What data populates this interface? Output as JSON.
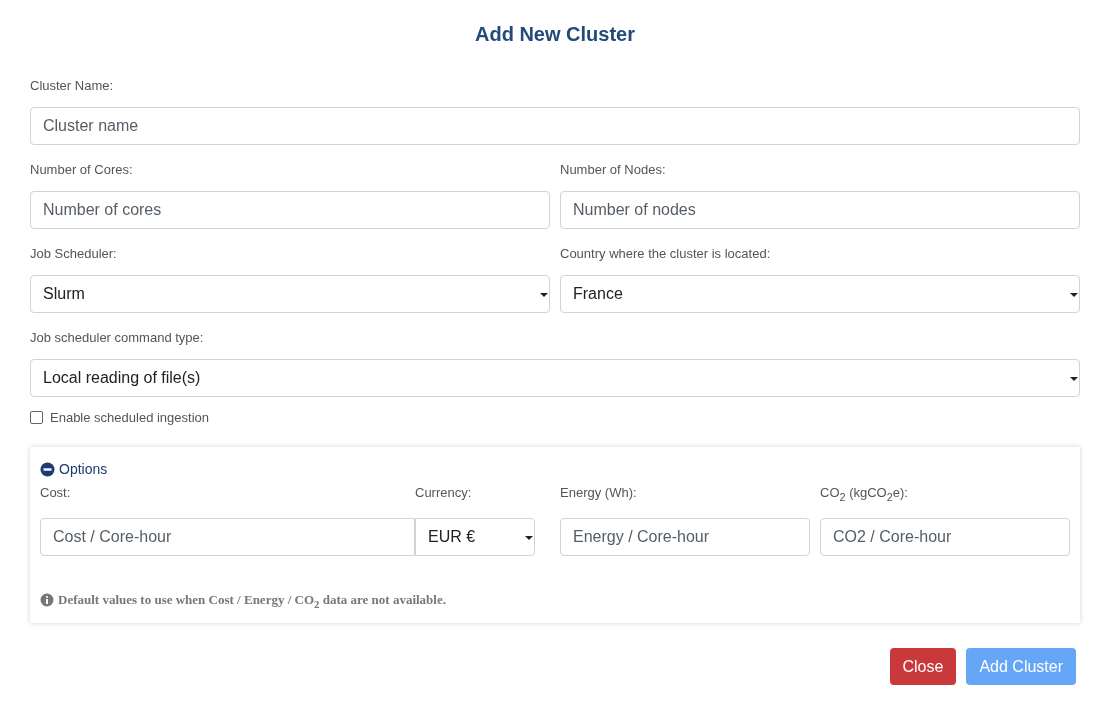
{
  "title": "Add New Cluster",
  "rows": [
    {
      "fields": [
        {
          "kind": "input",
          "label": "Cluster Name:",
          "placeholder": "Cluster name"
        }
      ]
    },
    {
      "fields": [
        {
          "kind": "input",
          "label": "Number of Cores:",
          "placeholder": "Number of cores"
        },
        {
          "kind": "input",
          "label": "Number of Nodes:",
          "placeholder": "Number of nodes"
        }
      ]
    },
    {
      "fields": [
        {
          "kind": "select",
          "label": "Job Scheduler:",
          "value": "Slurm"
        },
        {
          "kind": "select",
          "label": "Country where the cluster is located:",
          "value": "France"
        }
      ]
    },
    {
      "fields": [
        {
          "kind": "select",
          "label": "Job scheduler command type:",
          "value": "Local reading of file(s)"
        }
      ]
    }
  ],
  "scheduled_ingestion": {
    "label": "Enable scheduled ingestion",
    "checked": false
  },
  "options": {
    "label": "Options",
    "expanded": true,
    "cost": {
      "label": "Cost:",
      "placeholder": "Cost / Core-hour"
    },
    "currency": {
      "label": "Currency:",
      "value": "EUR €"
    },
    "energy": {
      "label": "Energy (Wh):",
      "placeholder": "Energy / Core-hour"
    },
    "co2": {
      "label": "CO$_{2}$ (kgCO$_{2}$e):",
      "placeholder": "CO2 / Core-hour"
    },
    "note": "Default values to use when Cost / Energy / CO$_{2}$ data are not available."
  },
  "buttons": [
    {
      "kind": "danger",
      "label": "Close"
    },
    {
      "kind": "primary",
      "label": "Add Cluster"
    }
  ]
}
